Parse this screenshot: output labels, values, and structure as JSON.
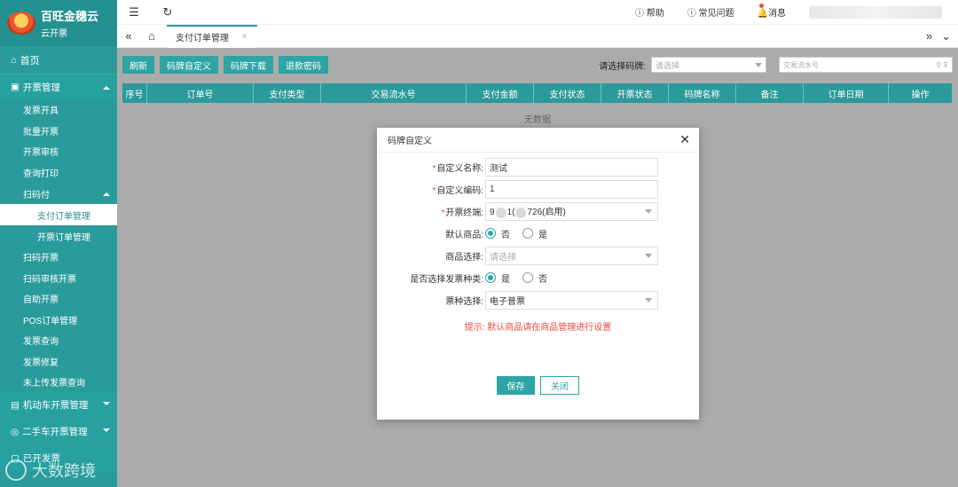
{
  "brand": {
    "name": "百旺金穗云",
    "sub": "云开票"
  },
  "sidebar": {
    "home": "首页",
    "group_invoice": "开票管理",
    "items": [
      "发票开具",
      "批量开票",
      "开票审核",
      "查询打印"
    ],
    "scan_pay": "扫码付",
    "scan_sub": [
      "支付订单管理",
      "开票订单管理"
    ],
    "items2": [
      "扫码开票",
      "扫码审核开票",
      "自助开票",
      "POS订单管理",
      "发票查询",
      "发票修复",
      "未上传发票查询"
    ],
    "group_vehicle": "机动车开票管理",
    "group_used_car": "二手车开票管理",
    "group_last": "已开发票",
    "watermark": "大数跨境"
  },
  "topbar": {
    "help": "帮助",
    "faq": "常见问题",
    "messages": "消息"
  },
  "tabs": {
    "active": "支付订单管理"
  },
  "toolbar": {
    "refresh": "刷新",
    "custom_code": "码牌自定义",
    "download_code": "码牌下载",
    "refund_pwd": "退款密码",
    "select_label": "请选择码牌:",
    "select_placeholder": "请选择",
    "search_placeholder": "交易流水号"
  },
  "table": {
    "columns": [
      "序号",
      "订单号",
      "支付类型",
      "交易流水号",
      "支付金额",
      "支付状态",
      "开票状态",
      "码牌名称",
      "备注",
      "订单日期",
      "操作"
    ],
    "empty": "无数据"
  },
  "modal": {
    "title": "码牌自定义",
    "name_label": "自定义名称:",
    "name_value": "测试",
    "code_label": "自定义编码:",
    "code_value": "1",
    "terminal_label": "开票终端:",
    "terminal_prefix": "9",
    "terminal_mid": "1(",
    "terminal_suffix": "726(启用)",
    "default_goods_label": "默认商品:",
    "default_goods_no": "否",
    "default_goods_yes": "是",
    "goods_select_label": "商品选择:",
    "goods_select_placeholder": "请选择",
    "choose_type_label": "是否选择发票种类:",
    "choose_type_yes": "是",
    "choose_type_no": "否",
    "ticket_type_label": "票种选择:",
    "ticket_type_value": "电子普票",
    "tip": "提示: 默认商品请在商品管理进行设置",
    "save": "保存",
    "close": "关闭"
  },
  "colors": {
    "accent": "#2a9b9b",
    "danger": "#e94b3c"
  }
}
